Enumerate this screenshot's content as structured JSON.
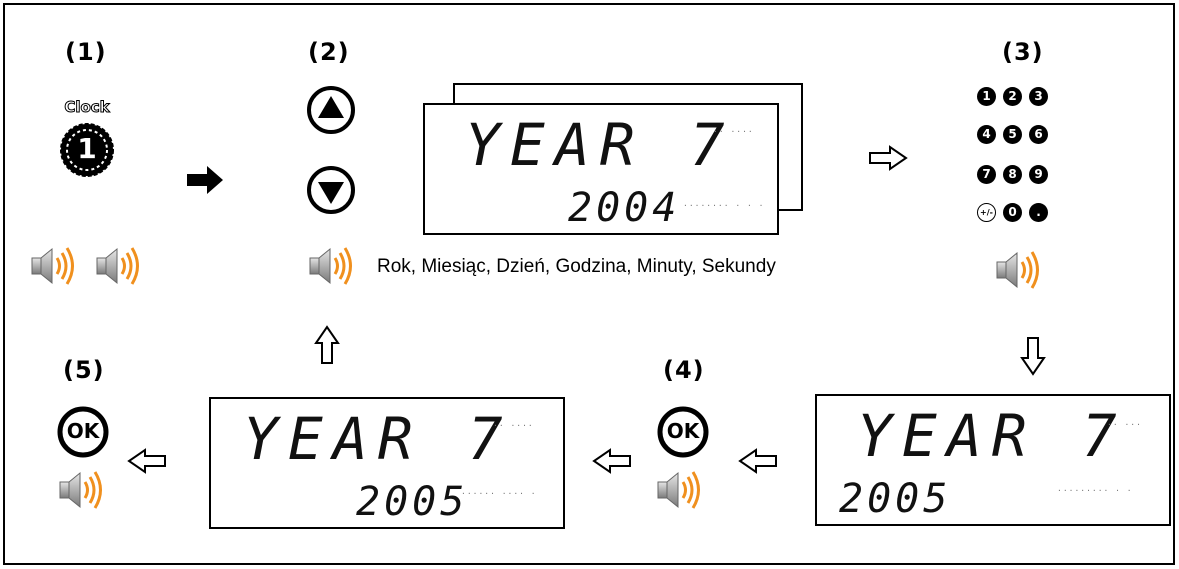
{
  "steps": {
    "s1": "(1)",
    "s2": "(2)",
    "s3": "(3)",
    "s4": "(4)",
    "s5": "(5)"
  },
  "clock_key": {
    "label": "Clock",
    "number": "1"
  },
  "caption": "Rok, Miesiąc, Dzień, Godzina, Minuty, Sekundy",
  "ok_label": "OK",
  "keypad": [
    {
      "label": "1"
    },
    {
      "label": "2"
    },
    {
      "label": "3"
    },
    {
      "label": "4"
    },
    {
      "label": "5"
    },
    {
      "label": "6"
    },
    {
      "label": "7"
    },
    {
      "label": "8"
    },
    {
      "label": "9"
    },
    {
      "label": "+/-"
    },
    {
      "label": "0"
    },
    {
      "label": "."
    }
  ],
  "displays": {
    "d2": {
      "line1": "YEAR 7",
      "line2": "2004"
    },
    "d3": {
      "line1": "YEAR 7",
      "line2": "2005"
    },
    "d5": {
      "line1": "YEAR 7",
      "line2": "2005"
    }
  },
  "icons": {
    "arrow_filled": "arrow-right-filled-icon",
    "arrow_outline": "arrow-outline-icon",
    "speaker": "speaker-sound-icon",
    "up": "up-triangle-button-icon",
    "down": "down-triangle-button-icon"
  },
  "colors": {
    "sound_waves": "#f0901e",
    "speaker_body": "#9a9a9a"
  }
}
